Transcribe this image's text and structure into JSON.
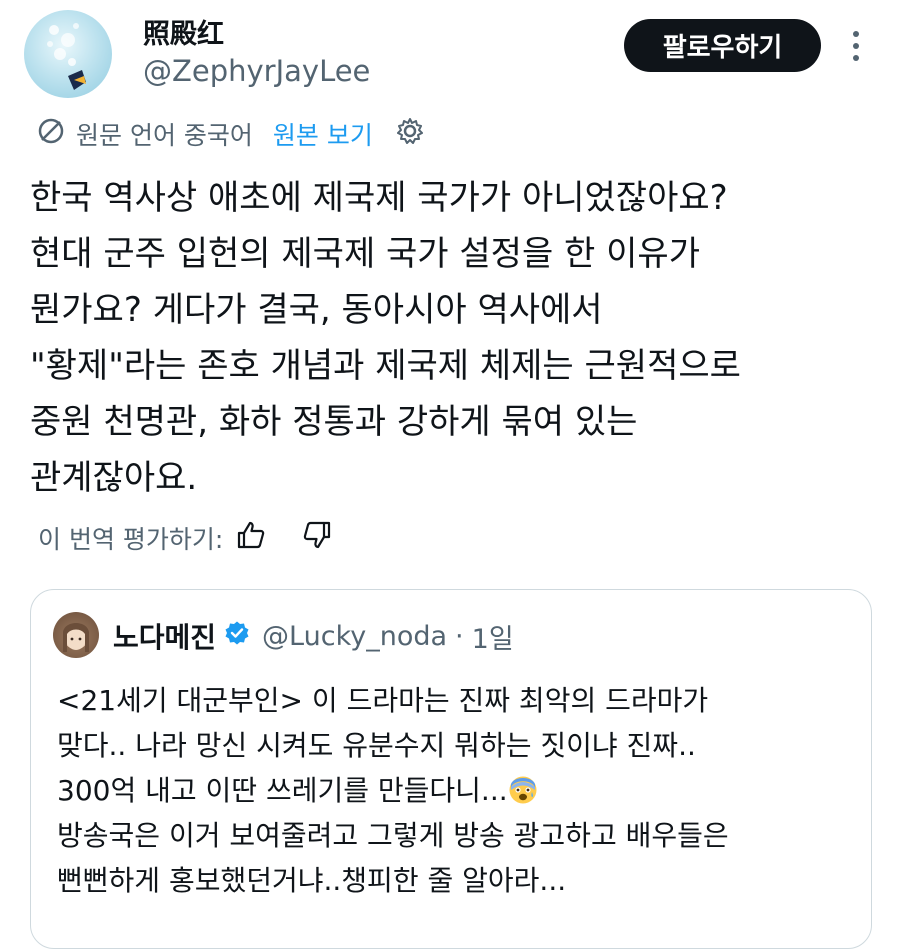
{
  "author": {
    "display_name": "照殿红",
    "handle": "@ZephyrJayLee"
  },
  "actions": {
    "follow_label": "팔로우하기",
    "more_icon": "more-vertical-icon"
  },
  "translation": {
    "icon": "translate-icon",
    "source_language_text": "원문 언어 중국어",
    "show_original_label": "원본 보기",
    "settings_icon": "gear-icon"
  },
  "tweet": {
    "text": "한국 역사상 애초에 제국제 국가가 아니었잖아요?\n현대 군주 입헌의 제국제 국가 설정을 한 이유가\n뭔가요? 게다가 결국, 동아시아 역사에서\n\"황제\"라는 존호 개념과 제국제 체제는 근원적으로\n중원 천명관, 화하 정통과 강하게 묶여 있는\n관계잖아요."
  },
  "rating": {
    "label": "이 번역 평가하기:",
    "thumbs_up_icon": "thumbs-up-icon",
    "thumbs_down_icon": "thumbs-down-icon"
  },
  "quoted": {
    "display_name": "노다메진",
    "verified_icon": "verified-badge-icon",
    "handle": "@Lucky_noda",
    "separator": "·",
    "time": "1일",
    "text_part1": "<21세기 대군부인> 이 드라마는 진짜 최악의 드라마가\n맞다.. 나라 망신 시켜도 유분수지 뭐하는 짓이냐 진짜..\n300억 내고 이딴 쓰레기를 만들다니...",
    "emoji_icon": "anxious-face-emoji-icon",
    "text_part2": "\n방송국은 이거 보여줄려고 그렇게 방송 광고하고 배우들은\n뻔뻔하게 홍보했던거냐..챙피한 줄 알아라..."
  },
  "colors": {
    "text_primary": "#0f1419",
    "text_secondary": "#536471",
    "accent": "#1d9bf0",
    "button_bg": "#0f1419",
    "border": "#cfd9de"
  }
}
